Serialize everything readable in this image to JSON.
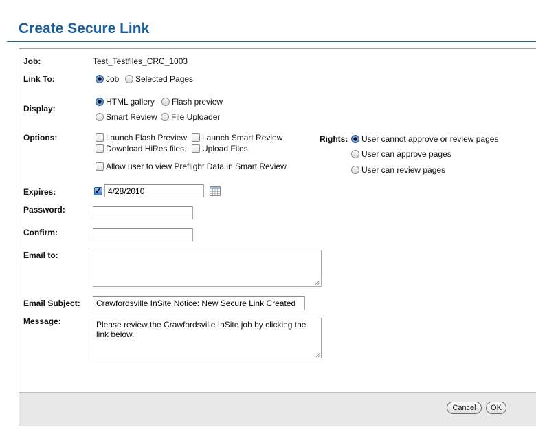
{
  "dialog": {
    "title": "Create Secure Link"
  },
  "job": {
    "label": "Job:",
    "value": "Test_Testfiles_CRC_1003"
  },
  "link_to": {
    "label": "Link To:",
    "options": [
      "Job",
      "Selected Pages"
    ],
    "selected": "Job"
  },
  "display": {
    "label": "Display:",
    "options": [
      "HTML gallery",
      "Flash preview",
      "Smart Review",
      "File Uploader"
    ],
    "selected": "HTML gallery"
  },
  "options": {
    "label": "Options:",
    "items": [
      "Launch Flash Preview",
      "Launch Smart Review",
      "Download HiRes files.",
      "Upload Files",
      "Allow user to view Preflight Data in Smart Review"
    ]
  },
  "rights": {
    "label": "Rights:",
    "options": [
      "User cannot approve or review pages",
      "User can approve pages",
      "User can review pages"
    ],
    "selected": "User cannot approve or review pages"
  },
  "expires": {
    "label": "Expires:",
    "checked": true,
    "value": "4/28/2010"
  },
  "password": {
    "label": "Password:",
    "value": ""
  },
  "confirm": {
    "label": "Confirm:",
    "value": ""
  },
  "email_to": {
    "label": "Email to:",
    "value": ""
  },
  "email_subject": {
    "label": "Email Subject:",
    "value": "Crawfordsville InSite Notice: New Secure Link Created"
  },
  "message": {
    "label": "Message:",
    "value": "Please review the Crawfordsville InSite job by clicking the link below."
  },
  "buttons": {
    "cancel": "Cancel",
    "ok": "OK"
  },
  "colors": {
    "title": "#1a5f9e",
    "footer": "#e8e8e8"
  }
}
